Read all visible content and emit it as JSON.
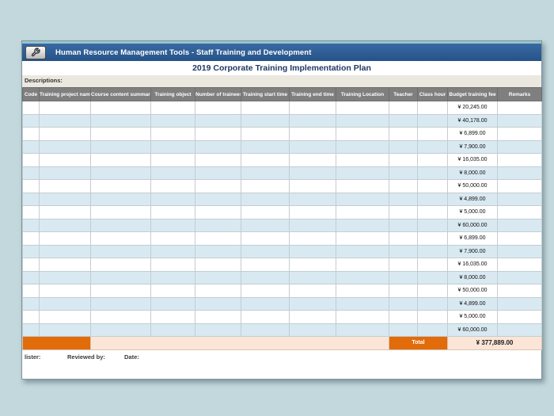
{
  "titlebar": {
    "icon": "wrench-icon",
    "title": "Human Resource Management Tools - Staff Training and Development"
  },
  "sheet": {
    "title": "2019 Corporate Training Implementation Plan",
    "descriptions_label": "Descriptions:",
    "columns": [
      "Code",
      "Training project name",
      "Course content summary",
      "Training object",
      "Number of trainees",
      "Training start time",
      "Training end time",
      "Training Location",
      "Teacher",
      "Class hour",
      "Budget training fee",
      "Remarks"
    ],
    "fees": [
      "¥ 20,245.00",
      "¥ 40,178.00",
      "¥ 6,899.00",
      "¥ 7,900.00",
      "¥ 16,035.00",
      "¥ 8,000.00",
      "¥ 50,000.00",
      "¥ 4,899.00",
      "¥ 5,000.00",
      "¥ 60,000.00",
      "¥ 6,899.00",
      "¥ 7,900.00",
      "¥ 16,035.00",
      "¥ 8,000.00",
      "¥ 50,000.00",
      "¥ 4,899.00",
      "¥ 5,000.00",
      "¥ 60,000.00"
    ],
    "total_label": "Total",
    "total_value": "¥ 377,889.00"
  },
  "footer": {
    "lister_label": "lister:",
    "reviewed_by_label": "Reviewed by:",
    "date_label": "Date:"
  },
  "colors": {
    "page_background": "#c3d8dd",
    "titlebar_blue": "#2b5d97",
    "header_gray": "#7f7f7f",
    "stripe_blue": "#d9e9f1",
    "accent_orange": "#e26b0a",
    "total_peach": "#fbe5d6",
    "top_strip_teal": "#96c5cd",
    "title_text_navy": "#1f3864"
  }
}
